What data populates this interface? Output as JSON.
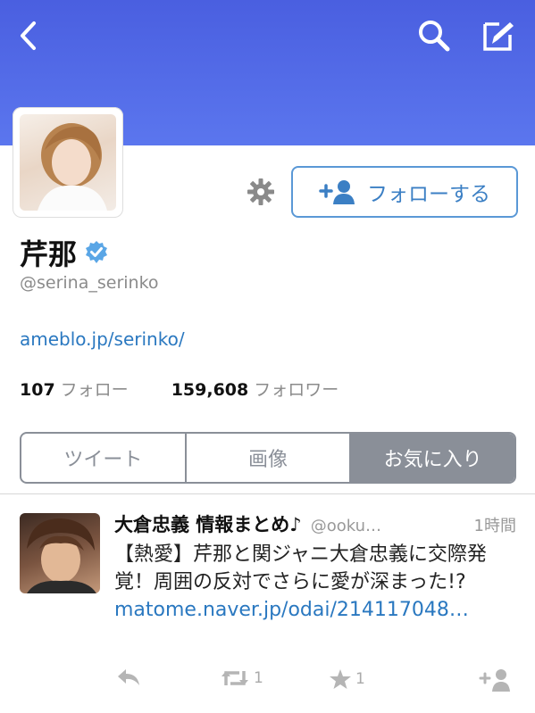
{
  "header": {
    "back_icon": "chevron-left-icon",
    "search_icon": "search-icon",
    "compose_icon": "compose-icon"
  },
  "profile": {
    "name": "芹那",
    "verified": true,
    "handle": "@serina_serinko",
    "url": "ameblo.jp/serinko/",
    "follow_button_label": "フォローする",
    "following_count": "107",
    "following_label": "フォロー",
    "followers_count": "159,608",
    "followers_label": "フォロワー"
  },
  "tabs": [
    {
      "label": "ツイート",
      "active": false
    },
    {
      "label": "画像",
      "active": false
    },
    {
      "label": "お気に入り",
      "active": true
    }
  ],
  "tweet": {
    "author": "大倉忠義 情報まとめ♪",
    "handle": "@ooku…",
    "time": "1時間",
    "text": "【熱愛】芹那と関ジャニ大倉忠義に交際発覚！周囲の反対でさらに愛が深まった!? ",
    "link": "matome.naver.jp/odai/214117048…",
    "retweet_count": "1",
    "favorite_count": "1"
  },
  "colors": {
    "header": "#5168e6",
    "link": "#2a78c0",
    "follow_border": "#5a98d6",
    "tab_active": "#8a8f98"
  }
}
